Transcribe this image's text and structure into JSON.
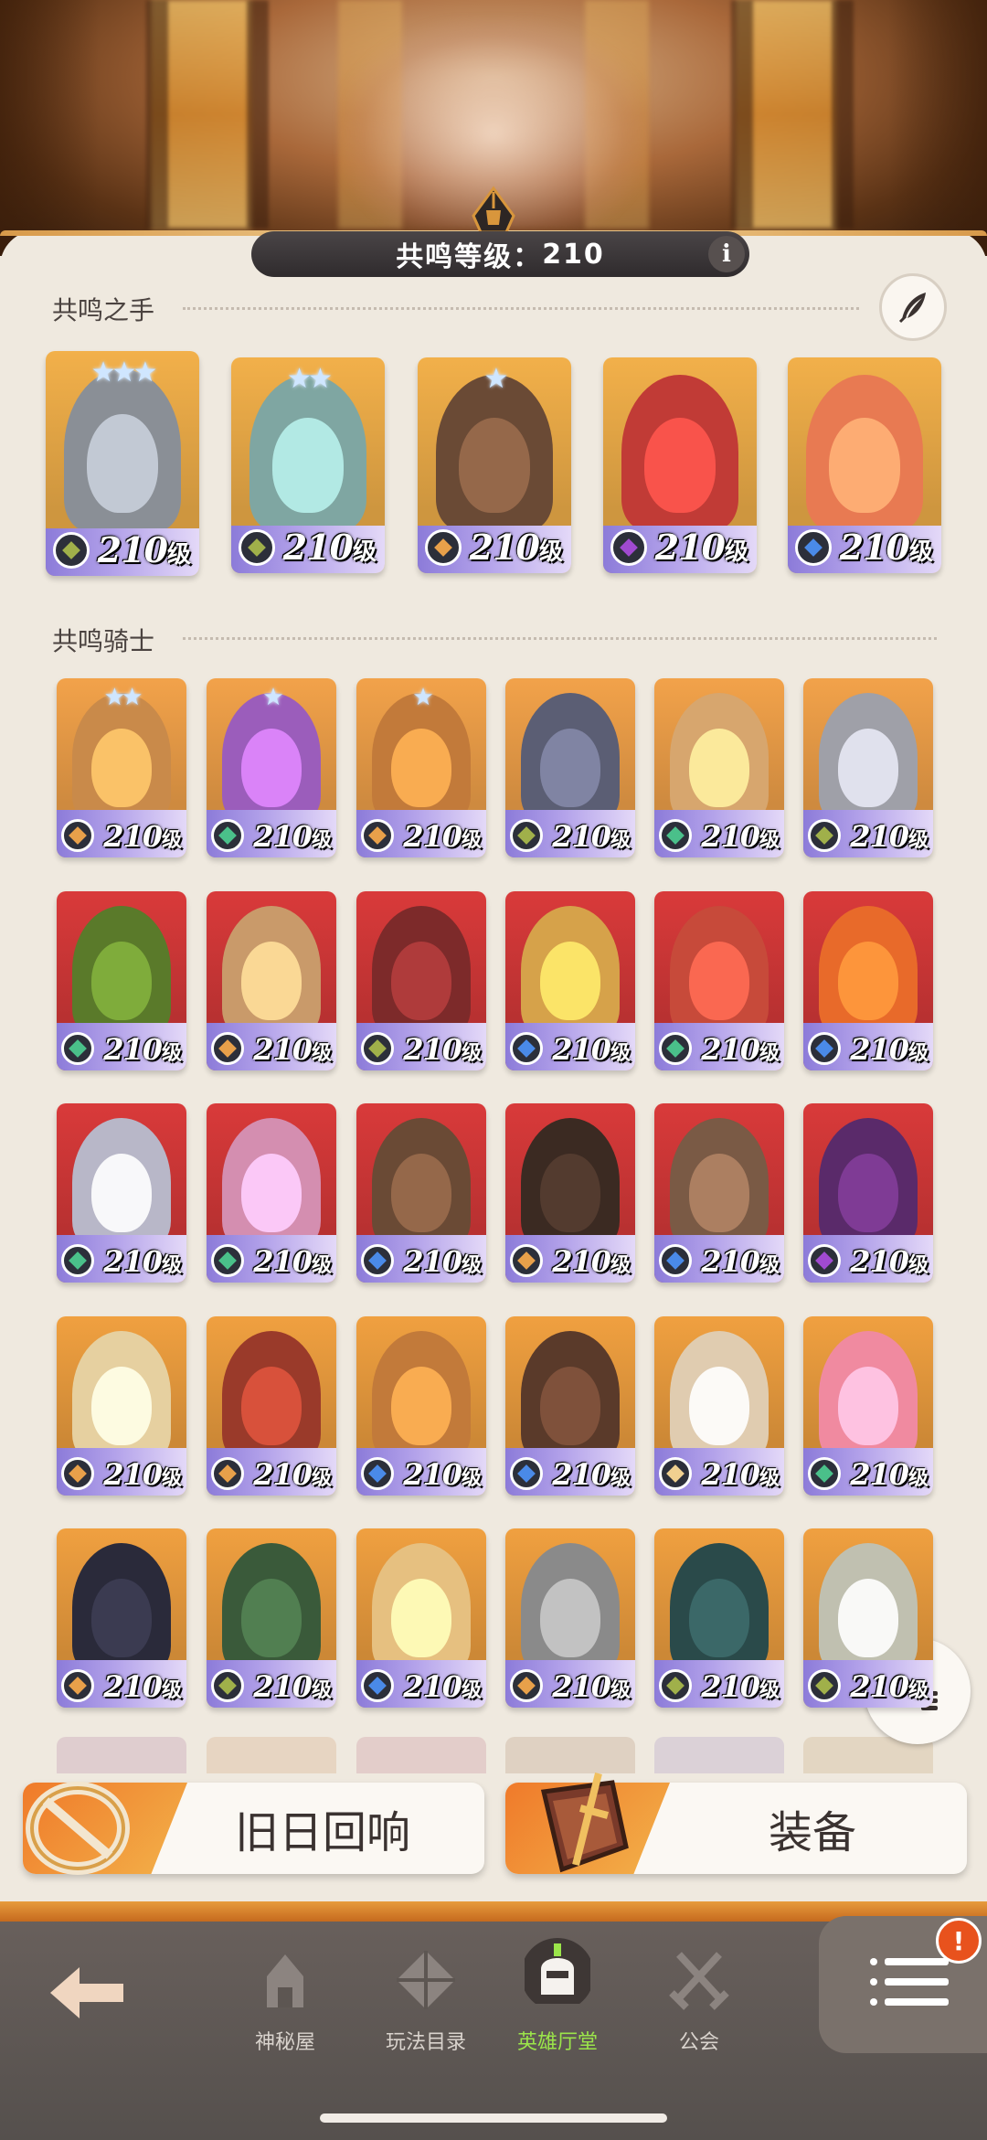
{
  "header": {
    "resonance_level_label": "共鸣等级：",
    "resonance_level_value": "210",
    "info_label": "i"
  },
  "sections": {
    "hands_title": "共鸣之手",
    "knights_title": "共鸣骑士"
  },
  "level_suffix": "级",
  "hands": [
    {
      "level": "210",
      "stars": "★★★",
      "faction": "graveborn",
      "theme": "#8a8f96"
    },
    {
      "level": "210",
      "stars": "★★",
      "faction": "graveborn",
      "theme": "#7fa6a2"
    },
    {
      "level": "210",
      "stars": "★",
      "faction": "lightbearer",
      "theme": "#6a4a35"
    },
    {
      "level": "210",
      "stars": "",
      "faction": "mauler",
      "theme": "#c13b36"
    },
    {
      "level": "210",
      "stars": "",
      "faction": "celestial",
      "theme": "#e87a52"
    }
  ],
  "knights": [
    {
      "level": "210",
      "stars": "★★",
      "faction": "lightbearer",
      "theme": "#c98a4a"
    },
    {
      "level": "210",
      "stars": "★",
      "faction": "wilder",
      "theme": "#9b5dbb"
    },
    {
      "level": "210",
      "stars": "★",
      "faction": "lightbearer",
      "theme": "#c27a3a"
    },
    {
      "level": "210",
      "stars": "",
      "faction": "graveborn",
      "theme": "#5b5e74"
    },
    {
      "level": "210",
      "stars": "",
      "faction": "wilder",
      "theme": "#d7a66e"
    },
    {
      "level": "210",
      "stars": "",
      "faction": "graveborn",
      "theme": "#9fa0a8"
    },
    {
      "level": "210",
      "stars": "",
      "faction": "wilder",
      "theme": "#5a7a2a"
    },
    {
      "level": "210",
      "stars": "",
      "faction": "lightbearer",
      "theme": "#c99a6a"
    },
    {
      "level": "210",
      "stars": "",
      "faction": "graveborn",
      "theme": "#7d2a2a"
    },
    {
      "level": "210",
      "stars": "",
      "faction": "celestial",
      "theme": "#d6a24a"
    },
    {
      "level": "210",
      "stars": "",
      "faction": "wilder",
      "theme": "#c74a3a"
    },
    {
      "level": "210",
      "stars": "",
      "faction": "celestial",
      "theme": "#e86a2a"
    },
    {
      "level": "210",
      "stars": "",
      "faction": "wilder",
      "theme": "#b8b7c8"
    },
    {
      "level": "210",
      "stars": "",
      "faction": "wilder",
      "theme": "#d48eb0"
    },
    {
      "level": "210",
      "stars": "",
      "faction": "celestial",
      "theme": "#6a4a35"
    },
    {
      "level": "210",
      "stars": "",
      "faction": "lightbearer",
      "theme": "#3b2a22"
    },
    {
      "level": "210",
      "stars": "",
      "faction": "celestial",
      "theme": "#7a5a45"
    },
    {
      "level": "210",
      "stars": "",
      "faction": "mauler",
      "theme": "#5a2a6a"
    },
    {
      "level": "210",
      "stars": "",
      "faction": "lightbearer",
      "theme": "#e6d0a0"
    },
    {
      "level": "210",
      "stars": "",
      "faction": "lightbearer",
      "theme": "#9a3a2a"
    },
    {
      "level": "210",
      "stars": "",
      "faction": "celestial",
      "theme": "#c27a3a"
    },
    {
      "level": "210",
      "stars": "",
      "faction": "celestial",
      "theme": "#5a3a2a"
    },
    {
      "level": "210",
      "stars": "",
      "faction": "dimensional",
      "theme": "#e0ccb0"
    },
    {
      "level": "210",
      "stars": "",
      "faction": "wilder",
      "theme": "#f08aa0"
    },
    {
      "level": "210",
      "stars": "",
      "faction": "lightbearer",
      "theme": "#2a2a3a"
    },
    {
      "level": "210",
      "stars": "",
      "faction": "graveborn",
      "theme": "#3a5a3a"
    },
    {
      "level": "210",
      "stars": "",
      "faction": "celestial",
      "theme": "#e6c080"
    },
    {
      "level": "210",
      "stars": "",
      "faction": "lightbearer",
      "theme": "#8a8a8a"
    },
    {
      "level": "210",
      "stars": "",
      "faction": "graveborn",
      "theme": "#2a4a4a"
    },
    {
      "level": "210",
      "stars": "",
      "faction": "graveborn",
      "theme": "#c0c0b0"
    }
  ],
  "faction_colors": {
    "graveborn": "#a0b04a",
    "lightbearer": "#e8a04a",
    "mauler": "#a04ad0",
    "wilder": "#4ac08a",
    "celestial": "#4a8ae8",
    "dimensional": "#f0d090"
  },
  "actions": {
    "echoes_label": "旧日回响",
    "equipment_label": "装备"
  },
  "nav": {
    "back_label": "",
    "items": [
      {
        "label": "神秘屋"
      },
      {
        "label": "玩法目录"
      },
      {
        "label": "英雄厅堂"
      },
      {
        "label": "公会"
      }
    ],
    "active_index": 2,
    "notification_badge": "!"
  },
  "colors": {
    "accent": "#f07a2a",
    "active_nav": "#9be54a",
    "panel_bg": "#efe9df"
  }
}
